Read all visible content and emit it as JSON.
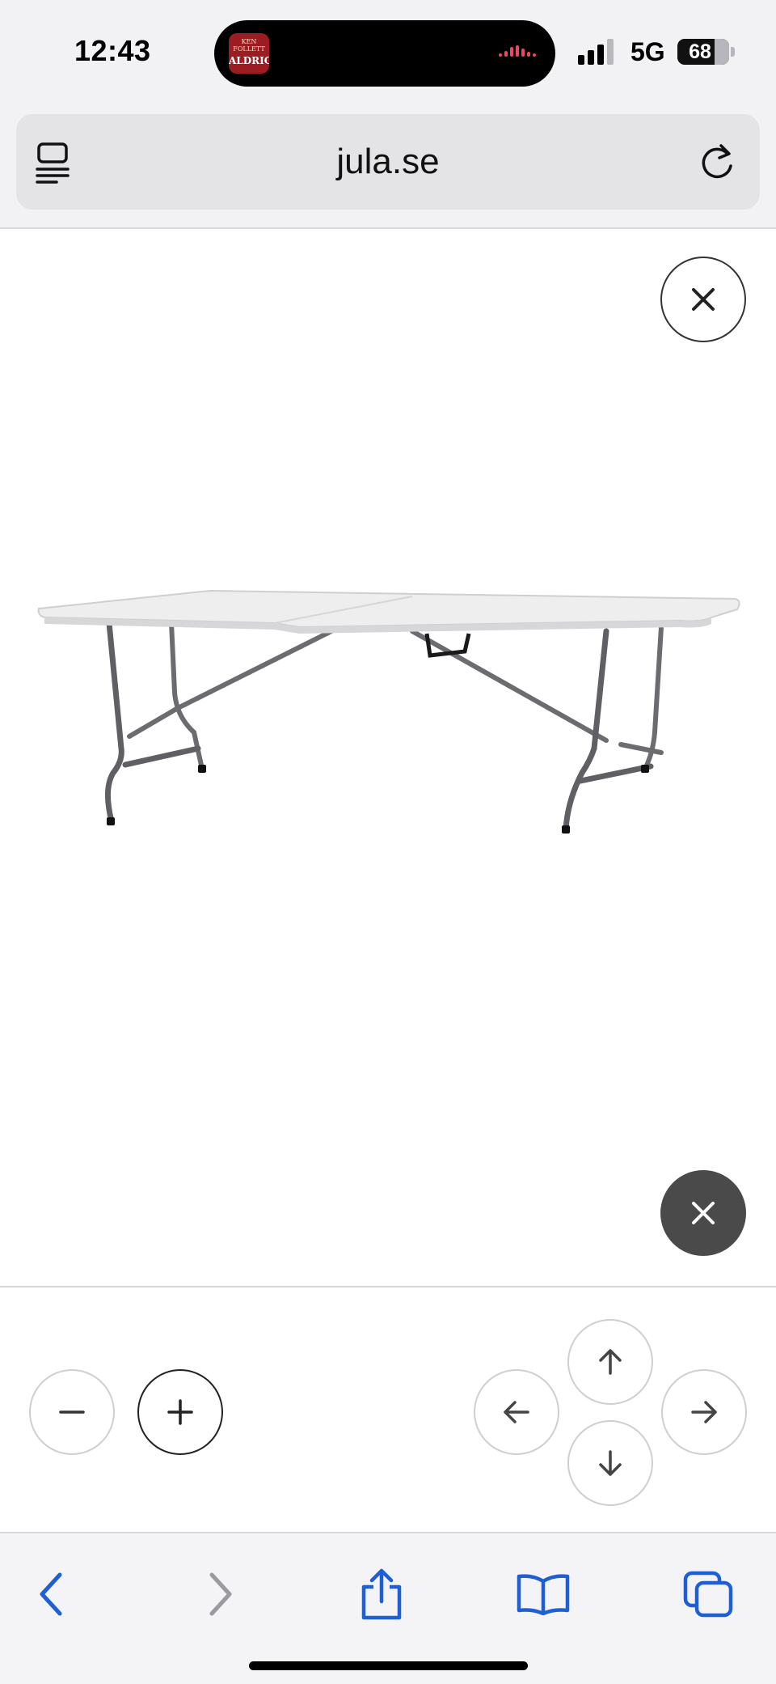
{
  "status_bar": {
    "time": "12:43",
    "now_playing": {
      "art_lines": [
        "KEN",
        "FOLLETT",
        "ALDRIG"
      ],
      "wave_color": "#e84a5f"
    },
    "network": "5G",
    "battery_percent": "68",
    "signal_bars_filled": 3
  },
  "browser": {
    "url": "jula.se",
    "left_icon": "reader-menu-icon",
    "right_icon": "reload-icon"
  },
  "viewer": {
    "image": "folding-table",
    "close_icon": "close-icon"
  },
  "controls": {
    "zoom_out_icon": "minus-icon",
    "zoom_in_icon": "plus-icon",
    "pan_icons": [
      "arrow-up-icon",
      "arrow-left-icon",
      "arrow-right-icon",
      "arrow-down-icon"
    ]
  },
  "toolbar": {
    "accent_color": "#1f5fd6",
    "items": [
      "back-icon",
      "forward-icon",
      "share-icon",
      "bookmarks-icon",
      "tabs-icon"
    ]
  }
}
